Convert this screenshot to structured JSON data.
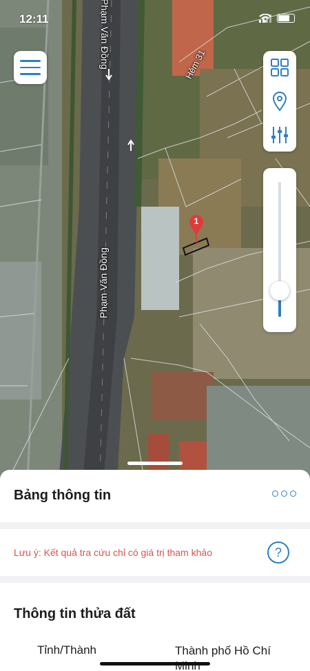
{
  "status_bar": {
    "time": "12:11"
  },
  "map": {
    "streets": {
      "top_street": "Phạm Văn Đồng",
      "alley": "Hẻm 31",
      "main_street": "Phạm Văn Đồng"
    },
    "marker_number": "1",
    "zoom_level_fraction": 0.12
  },
  "controls": {
    "menu_icon": "hamburger-menu-icon",
    "layers_icon": "grid-layers-icon",
    "location_icon": "location-pin-icon",
    "filter_icon": "sliders-icon"
  },
  "sheet": {
    "title": "Bảng thông tin",
    "note": "Lưu ý: Kết quả tra cứu chỉ có giá trị tham khảo",
    "help_label": "?",
    "info_title": "Thông tin thửa đất",
    "field_province_label": "Tỉnh/Thành",
    "field_province_value": "Thành phố Hồ Chí Minh"
  },
  "colors": {
    "accent": "#2d7fc1",
    "note_text": "#d9534f",
    "pin": "#e03b3b"
  }
}
